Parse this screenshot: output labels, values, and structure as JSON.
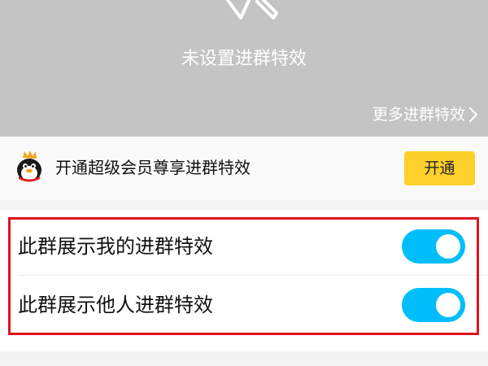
{
  "preview": {
    "status": "未设置进群特效",
    "more_link": "更多进群特效",
    "icon": "magic-wand-icon",
    "icon_chevron": "chevron-right-icon"
  },
  "promo": {
    "icon": "qq-vip-penguin-icon",
    "text": "开通超级会员尊享进群特效",
    "button_label": "开通"
  },
  "settings": [
    {
      "label": "此群展示我的进群特效",
      "enabled": true
    },
    {
      "label": "此群展示他人进群特效",
      "enabled": true
    }
  ],
  "colors": {
    "preview_bg": "#c4c4c4",
    "promo_button": "#fdd02b",
    "toggle_on": "#00bdfc",
    "highlight": "#e1121c"
  }
}
